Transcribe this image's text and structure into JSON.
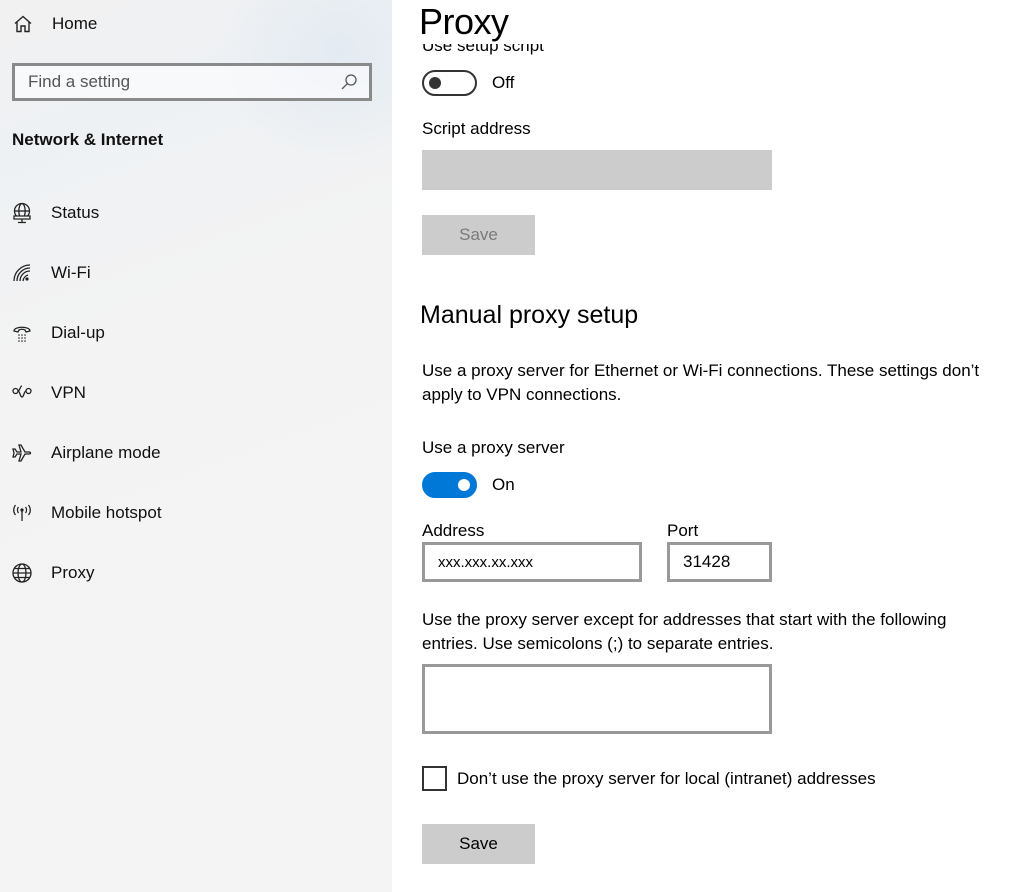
{
  "sidebar": {
    "home_label": "Home",
    "search": {
      "placeholder": "Find a setting",
      "value": ""
    },
    "section_title": "Network & Internet",
    "items": [
      {
        "label": "Status",
        "icon": "status-globe-monitor-icon"
      },
      {
        "label": "Wi-Fi",
        "icon": "wifi-icon"
      },
      {
        "label": "Dial-up",
        "icon": "dialup-phone-icon"
      },
      {
        "label": "VPN",
        "icon": "vpn-icon"
      },
      {
        "label": "Airplane mode",
        "icon": "airplane-icon"
      },
      {
        "label": "Mobile hotspot",
        "icon": "hotspot-icon"
      },
      {
        "label": "Proxy",
        "icon": "globe-icon"
      }
    ]
  },
  "main": {
    "title": "Proxy",
    "automatic": {
      "setup_script_label": "Use setup script",
      "setup_script_toggle": {
        "state": "Off",
        "on": false
      },
      "script_address_label": "Script address",
      "script_address_value": "",
      "save_label": "Save",
      "save_enabled": false
    },
    "manual": {
      "heading": "Manual proxy setup",
      "description": "Use a proxy server for Ethernet or Wi-Fi connections. These settings don’t apply to VPN connections.",
      "use_proxy_label": "Use a proxy server",
      "use_proxy_toggle": {
        "state": "On",
        "on": true
      },
      "address_label": "Address",
      "address_value": "xxx.xxx.xx.xxx",
      "port_label": "Port",
      "port_value": "31428",
      "exceptions_description": "Use the proxy server except for addresses that start with the following entries. Use semicolons (;) to separate entries.",
      "exceptions_value": "",
      "bypass_local_label": "Don’t use the proxy server for local (intranet) addresses",
      "bypass_local_checked": false,
      "save_label": "Save",
      "save_enabled": true
    }
  },
  "colors": {
    "accent": "#0078d7",
    "disabled_fill": "#cccccc",
    "input_border": "#999999"
  }
}
